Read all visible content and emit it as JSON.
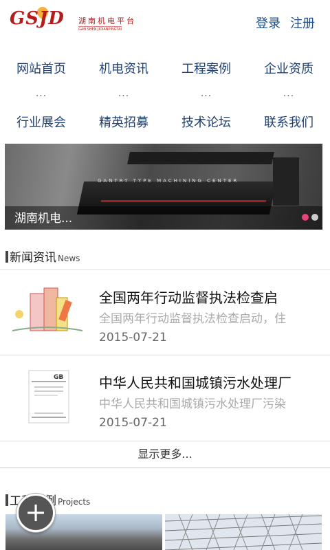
{
  "header": {
    "logo_mark": "GSJD",
    "logo_cn": "湖南机电平台",
    "logo_en": "GAN SHEN JIDIANPINGTAI",
    "login": "登录",
    "register": "注册"
  },
  "nav": {
    "row1": [
      "网站首页",
      "机电资讯",
      "工程案例",
      "企业资质"
    ],
    "row2": [
      "行业展会",
      "精英招募",
      "技术论坛",
      "联系我们"
    ],
    "ellipsis": "..."
  },
  "banner": {
    "title": "湖南机电...",
    "machine_text": "GANTRY TYPE MACHINING CENTER",
    "active_slide": 1,
    "slide_count": 2
  },
  "news_section": {
    "title": "新闻资讯",
    "subtitle": "News"
  },
  "news": [
    {
      "title": "全国两年行动监督执法检查启",
      "desc": "全国两年行动监督执法检查启动，住",
      "date": "2015-07-21",
      "thumb_icon": "building-cartoon-icon"
    },
    {
      "title": "中华人民共和国城镇污水处理厂",
      "desc": "中华人民共和国城镇污水处理厂污染",
      "date": "2015-07-21",
      "thumb_icon": "gb-standard-document-icon"
    }
  ],
  "more_label": "显示更多...",
  "projects_section": {
    "title": "工程案例",
    "subtitle": "Projects"
  },
  "fab_icon": "plus-icon",
  "colors": {
    "nav": "#1f3f73",
    "brand": "#b51d1d",
    "active_dot": "#e8427b"
  }
}
